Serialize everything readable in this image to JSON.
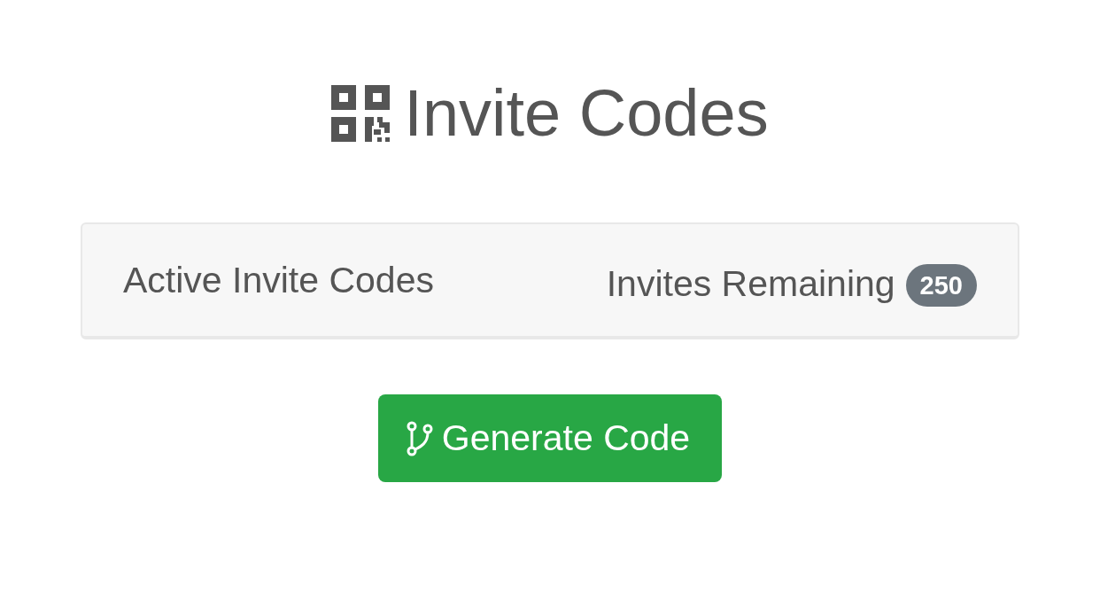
{
  "header": {
    "title": "Invite Codes"
  },
  "summary": {
    "active_label": "Active Invite Codes",
    "remaining": {
      "label": "Invites Remaining",
      "count": "250"
    }
  },
  "generate_button": {
    "label": "Generate Code"
  }
}
